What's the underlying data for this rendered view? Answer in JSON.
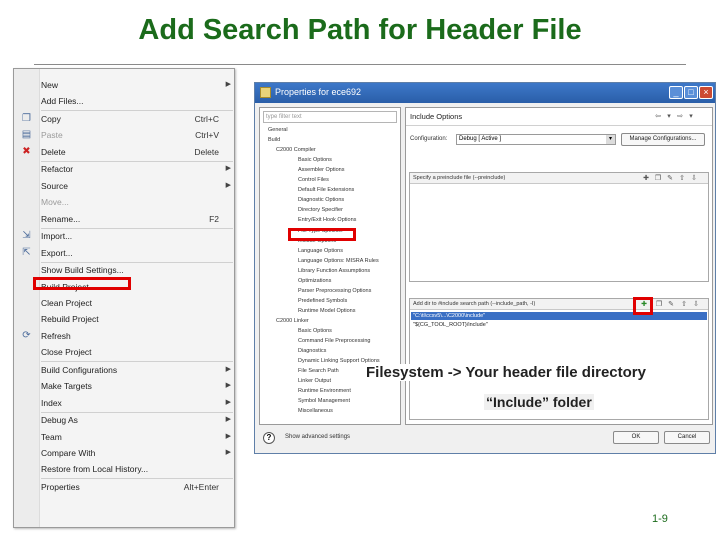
{
  "slide": {
    "title": "Add Search Path for Header File",
    "page_number": "1-9"
  },
  "context_menu": {
    "items": [
      {
        "label": "New",
        "shortcut": "",
        "submenu": true,
        "disabled": false,
        "icon": ""
      },
      {
        "label": "Add Files...",
        "shortcut": "",
        "submenu": false,
        "disabled": false,
        "icon": ""
      },
      {
        "label": "Copy",
        "shortcut": "Ctrl+C",
        "submenu": false,
        "disabled": false,
        "icon": "copy-icon"
      },
      {
        "label": "Paste",
        "shortcut": "Ctrl+V",
        "submenu": false,
        "disabled": true,
        "icon": "paste-icon"
      },
      {
        "label": "Delete",
        "shortcut": "Delete",
        "submenu": false,
        "disabled": false,
        "icon": "delete-icon"
      },
      {
        "label": "Refactor",
        "shortcut": "",
        "submenu": true,
        "disabled": false,
        "icon": ""
      },
      {
        "label": "Source",
        "shortcut": "",
        "submenu": true,
        "disabled": false,
        "icon": ""
      },
      {
        "label": "Move...",
        "shortcut": "",
        "submenu": false,
        "disabled": true,
        "icon": ""
      },
      {
        "label": "Rename...",
        "shortcut": "F2",
        "submenu": false,
        "disabled": false,
        "icon": ""
      },
      {
        "label": "Import...",
        "shortcut": "",
        "submenu": false,
        "disabled": false,
        "icon": "import-icon"
      },
      {
        "label": "Export...",
        "shortcut": "",
        "submenu": false,
        "disabled": false,
        "icon": "export-icon"
      },
      {
        "label": "Show Build Settings...",
        "shortcut": "",
        "submenu": false,
        "disabled": false,
        "icon": ""
      },
      {
        "label": "Build Project",
        "shortcut": "",
        "submenu": false,
        "disabled": false,
        "icon": ""
      },
      {
        "label": "Clean Project",
        "shortcut": "",
        "submenu": false,
        "disabled": false,
        "icon": ""
      },
      {
        "label": "Rebuild Project",
        "shortcut": "",
        "submenu": false,
        "disabled": false,
        "icon": ""
      },
      {
        "label": "Refresh",
        "shortcut": "",
        "submenu": false,
        "disabled": false,
        "icon": "refresh-icon"
      },
      {
        "label": "Close Project",
        "shortcut": "",
        "submenu": false,
        "disabled": false,
        "icon": ""
      },
      {
        "label": "Build Configurations",
        "shortcut": "",
        "submenu": true,
        "disabled": false,
        "icon": ""
      },
      {
        "label": "Make Targets",
        "shortcut": "",
        "submenu": true,
        "disabled": false,
        "icon": ""
      },
      {
        "label": "Index",
        "shortcut": "",
        "submenu": true,
        "disabled": false,
        "icon": ""
      },
      {
        "label": "Debug As",
        "shortcut": "",
        "submenu": true,
        "disabled": false,
        "icon": ""
      },
      {
        "label": "Team",
        "shortcut": "",
        "submenu": true,
        "disabled": false,
        "icon": ""
      },
      {
        "label": "Compare With",
        "shortcut": "",
        "submenu": true,
        "disabled": false,
        "icon": ""
      },
      {
        "label": "Restore from Local History...",
        "shortcut": "",
        "submenu": false,
        "disabled": false,
        "icon": ""
      },
      {
        "label": "Properties",
        "shortcut": "Alt+Enter",
        "submenu": false,
        "disabled": false,
        "icon": ""
      }
    ]
  },
  "dialog": {
    "title": "Properties for ece692",
    "filter_placeholder": "type filter text",
    "tree": [
      {
        "label": "General",
        "level": 1
      },
      {
        "label": "Build",
        "level": 1
      },
      {
        "label": "C2000 Compiler",
        "level": 2
      },
      {
        "label": "Basic Options",
        "level": 3
      },
      {
        "label": "Assembler Options",
        "level": 3
      },
      {
        "label": "Control Files",
        "level": 3
      },
      {
        "label": "Default File Extensions",
        "level": 3
      },
      {
        "label": "Diagnostic Options",
        "level": 3
      },
      {
        "label": "Directory Specifier",
        "level": 3
      },
      {
        "label": "Entry/Exit Hook Options",
        "level": 3
      },
      {
        "label": "File Type Specifier",
        "level": 3
      },
      {
        "label": "Include Options",
        "level": 3
      },
      {
        "label": "Language Options",
        "level": 3
      },
      {
        "label": "Language Options: MISRA Rules",
        "level": 3
      },
      {
        "label": "Library Function Assumptions",
        "level": 3
      },
      {
        "label": "Optimizations",
        "level": 3
      },
      {
        "label": "Parser Preprocessing Options",
        "level": 3
      },
      {
        "label": "Predefined Symbols",
        "level": 3
      },
      {
        "label": "Runtime Model Options",
        "level": 3
      },
      {
        "label": "C2000 Linker",
        "level": 2
      },
      {
        "label": "Basic Options",
        "level": 3
      },
      {
        "label": "Command File Preprocessing",
        "level": 3
      },
      {
        "label": "Diagnostics",
        "level": 3
      },
      {
        "label": "Dynamic Linking Support Options",
        "level": 3
      },
      {
        "label": "File Search Path",
        "level": 3
      },
      {
        "label": "Linker Output",
        "level": 3
      },
      {
        "label": "Runtime Environment",
        "level": 3
      },
      {
        "label": "Symbol Management",
        "level": 3
      },
      {
        "label": "Miscellaneous",
        "level": 3
      }
    ],
    "right": {
      "heading": "Include Options",
      "configuration_label": "Configuration:",
      "configuration_value": "Debug [ Active ]",
      "manage_button": "Manage Configurations...",
      "specify_header": "Specify a preinclude file (--preinclude)",
      "search_path_header": "Add dir to #include search path (--include_path, -I)",
      "paths": [
        "\"C:\\ti\\ccsv5\\...\\C2000\\include\"",
        "\"${CG_TOOL_ROOT}/include\""
      ]
    },
    "show_advanced": "Show advanced settings",
    "ok_label": "OK",
    "cancel_label": "Cancel"
  },
  "callouts": {
    "line1": "Filesystem -> Your header file directory",
    "line2": "“Include” folder"
  },
  "colors": {
    "title": "#1b6b1b",
    "highlight": "#e00000",
    "selection": "#3a6fc4"
  }
}
